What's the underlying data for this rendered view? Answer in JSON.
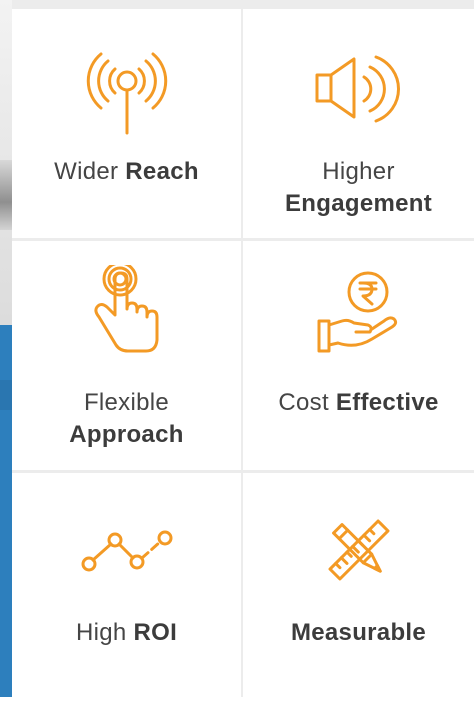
{
  "theme": {
    "icon_color": "#F39A25",
    "text_color": "#454545",
    "divider_color": "#ECECEC",
    "side_blue": "#2D7FBD"
  },
  "features": [
    {
      "icon": "antenna-signal-icon",
      "line1_light": "Wider",
      "line1_bold": "Reach",
      "line2_light": "",
      "line2_bold": ""
    },
    {
      "icon": "speaker-icon",
      "line1_light": "Higher",
      "line1_bold": "",
      "line2_light": "",
      "line2_bold": "Engagement"
    },
    {
      "icon": "touch-hand-icon",
      "line1_light": "Flexible",
      "line1_bold": "",
      "line2_light": "",
      "line2_bold": "Approach"
    },
    {
      "icon": "rupee-hand-icon",
      "line1_light": "Cost",
      "line1_bold": "Effective",
      "line2_light": "",
      "line2_bold": ""
    },
    {
      "icon": "line-graph-icon",
      "line1_light": "High",
      "line1_bold": "ROI",
      "line2_light": "",
      "line2_bold": ""
    },
    {
      "icon": "pencil-ruler-icon",
      "line1_light": "",
      "line1_bold": "Measurable",
      "line2_light": "",
      "line2_bold": ""
    }
  ]
}
